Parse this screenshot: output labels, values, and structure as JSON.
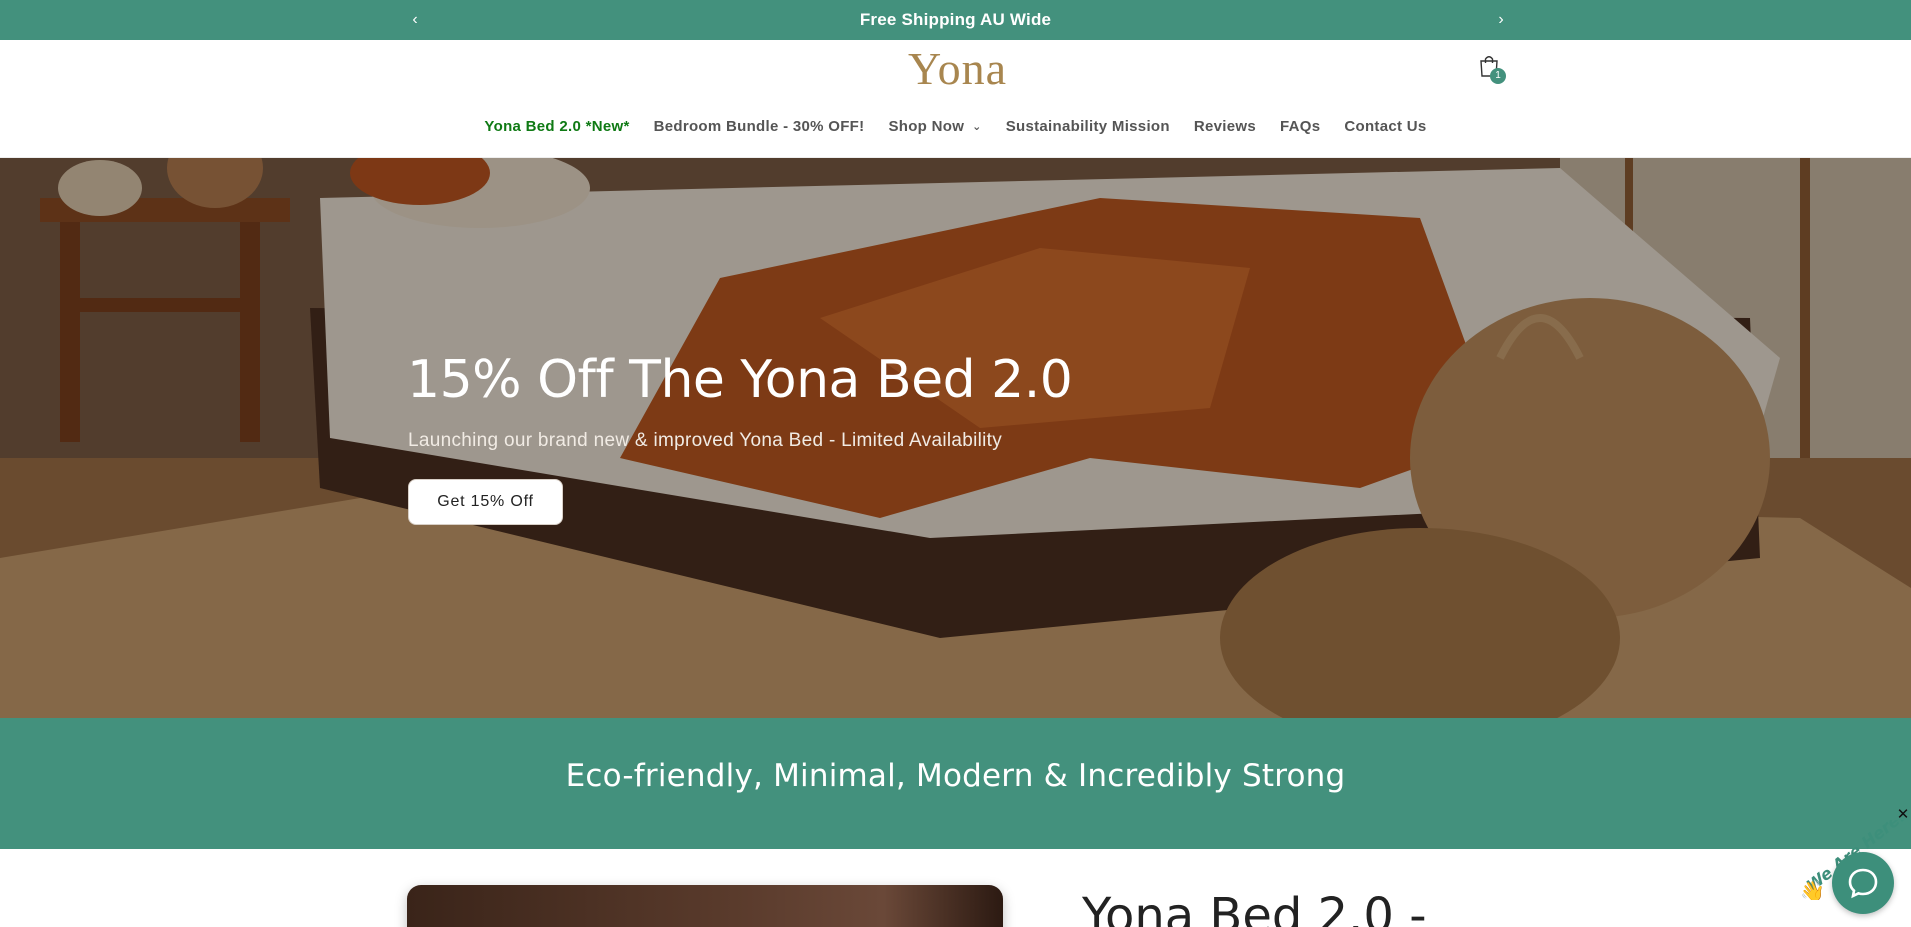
{
  "announcement": {
    "text": "Free Shipping AU Wide",
    "prev_icon": "‹",
    "next_icon": "›"
  },
  "header": {
    "logo": "Yona",
    "cart_count": "1"
  },
  "nav": {
    "items": [
      {
        "label": "Yona Bed 2.0 *New*",
        "active": true
      },
      {
        "label": "Bedroom Bundle - 30% OFF!"
      },
      {
        "label": "Shop Now",
        "has_dropdown": true
      },
      {
        "label": "Sustainability Mission"
      },
      {
        "label": "Reviews"
      },
      {
        "label": "FAQs"
      },
      {
        "label": "Contact Us"
      }
    ]
  },
  "hero": {
    "title": "15% Off The Yona Bed 2.0",
    "subtitle": "Launching our brand new & improved Yona Bed - Limited Availability",
    "button_label": "Get 15% Off"
  },
  "band": {
    "text": "Eco-friendly, Minimal, Modern & Incredibly Strong"
  },
  "product": {
    "title": "Yona Bed 2.0 -"
  },
  "chat": {
    "tag_text": "We Are Here!",
    "close_icon": "✕"
  },
  "colors": {
    "brand_green": "#43917d",
    "logo_gold": "#a8864f",
    "active_nav": "#0f7a14"
  }
}
